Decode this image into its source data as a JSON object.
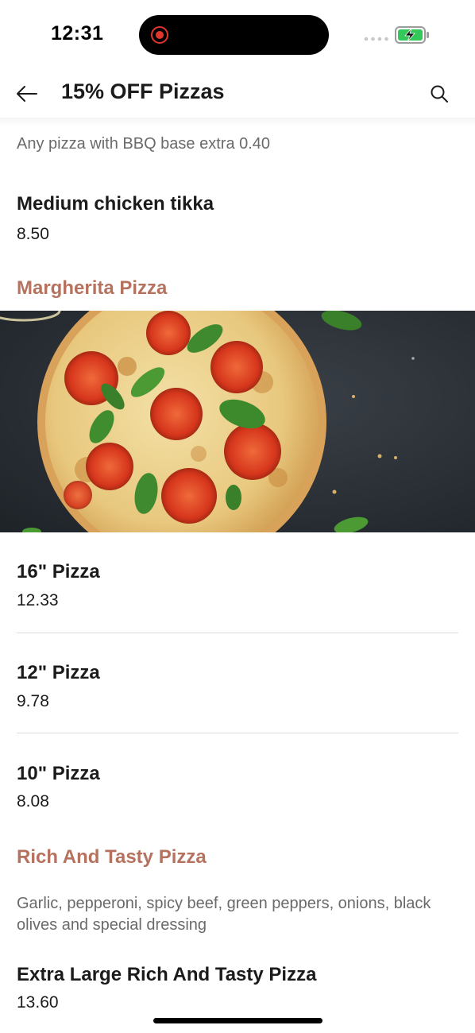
{
  "status_bar": {
    "time": "12:31"
  },
  "header": {
    "title": "15% OFF Pizzas",
    "back_icon": "arrow-left-icon",
    "search_icon": "search-icon"
  },
  "colors": {
    "section_title": "#b5725f",
    "text_primary": "#1b1b1b",
    "text_secondary": "#6a6a6a",
    "divider": "#dcdcdc",
    "battery_fill": "#34c759"
  },
  "menu": {
    "top_note": "Any pizza with BBQ base extra 0.40",
    "medium_chicken_tikka": {
      "name": "Medium chicken tikka",
      "price": "8.50"
    },
    "margherita": {
      "title": "Margherita Pizza",
      "items": [
        {
          "name": "16\" Pizza",
          "price": "12.33"
        },
        {
          "name": "12\" Pizza",
          "price": "9.78"
        },
        {
          "name": "10\" Pizza",
          "price": "8.08"
        }
      ]
    },
    "rich_and_tasty": {
      "title": "Rich And Tasty Pizza",
      "description": "Garlic, pepperoni, spicy beef, green peppers, onions, black olives and special dressing",
      "items": [
        {
          "name": "Extra Large Rich And Tasty Pizza",
          "price": "13.60"
        }
      ]
    }
  }
}
